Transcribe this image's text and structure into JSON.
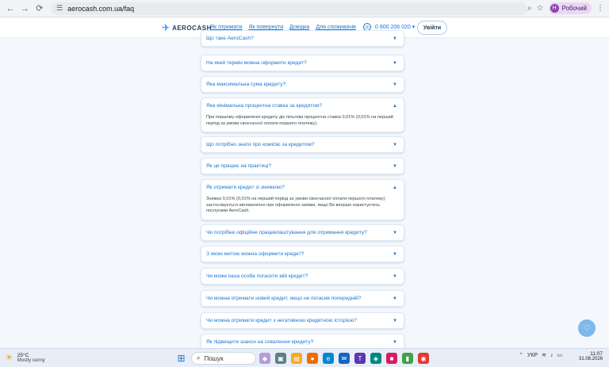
{
  "browser": {
    "url": "aerocash.com.ua/faq",
    "profile_initial": "Н",
    "profile_label": "Робочий"
  },
  "header": {
    "logo_text": "AEROCASH",
    "nav": [
      "Як отримати",
      "Як повернути",
      "Довідка",
      "Для споживачів"
    ],
    "phone": "0 800 206 020",
    "login_label": "Увійти"
  },
  "faq": [
    {
      "q": "Що таке AeroCash?",
      "open": false
    },
    {
      "q": "На який термін можна оформити кредит?",
      "open": false
    },
    {
      "q": "Яка максимальна сума кредиту?",
      "open": false
    },
    {
      "q": "Яка мінімальна процентна ставка за кредитом?",
      "open": true,
      "a": "При першому оформленні кредиту діє пільгова процентна ставка 0,01% (0,01% на перший період за умови своєчасної оплати першого платежу)."
    },
    {
      "q": "Що потрібно знати про комісію за кредитом?",
      "open": false
    },
    {
      "q": "Як це працює на практиці?",
      "open": false
    },
    {
      "q": "Як отримати кредит зі знижкою?",
      "open": true,
      "a": "Знижка 0,01% (0,01% на перший період за умови своєчасної оплати першого платежу) застосовується автоматично при оформленні заявки, якщо Ви вперше користуєтесь послугами AeroCash."
    },
    {
      "q": "Чи потрібне офіційне працевлаштування для отримання кредиту?",
      "open": false
    },
    {
      "q": "З якою метою можна оформити кредит?",
      "open": false
    },
    {
      "q": "Чи може інша особа погасити мій кредит?",
      "open": false
    },
    {
      "q": "Чи можна отримати новий кредит, якщо не погасив попередній?",
      "open": false
    },
    {
      "q": "Чи можна отримати кредит з негативною кредитною історією?",
      "open": false
    },
    {
      "q": "Як підвищити шанси на схвалення кредиту?",
      "open": false
    }
  ],
  "taskbar": {
    "weather_temp": "25°C",
    "weather_desc": "Mostly sunny",
    "search_label": "Пошук",
    "lang": "УКР",
    "time": "11:07",
    "date": "31.08.2026"
  },
  "colors": {
    "accent": "#1976d2",
    "background": "#f4f7fb"
  }
}
